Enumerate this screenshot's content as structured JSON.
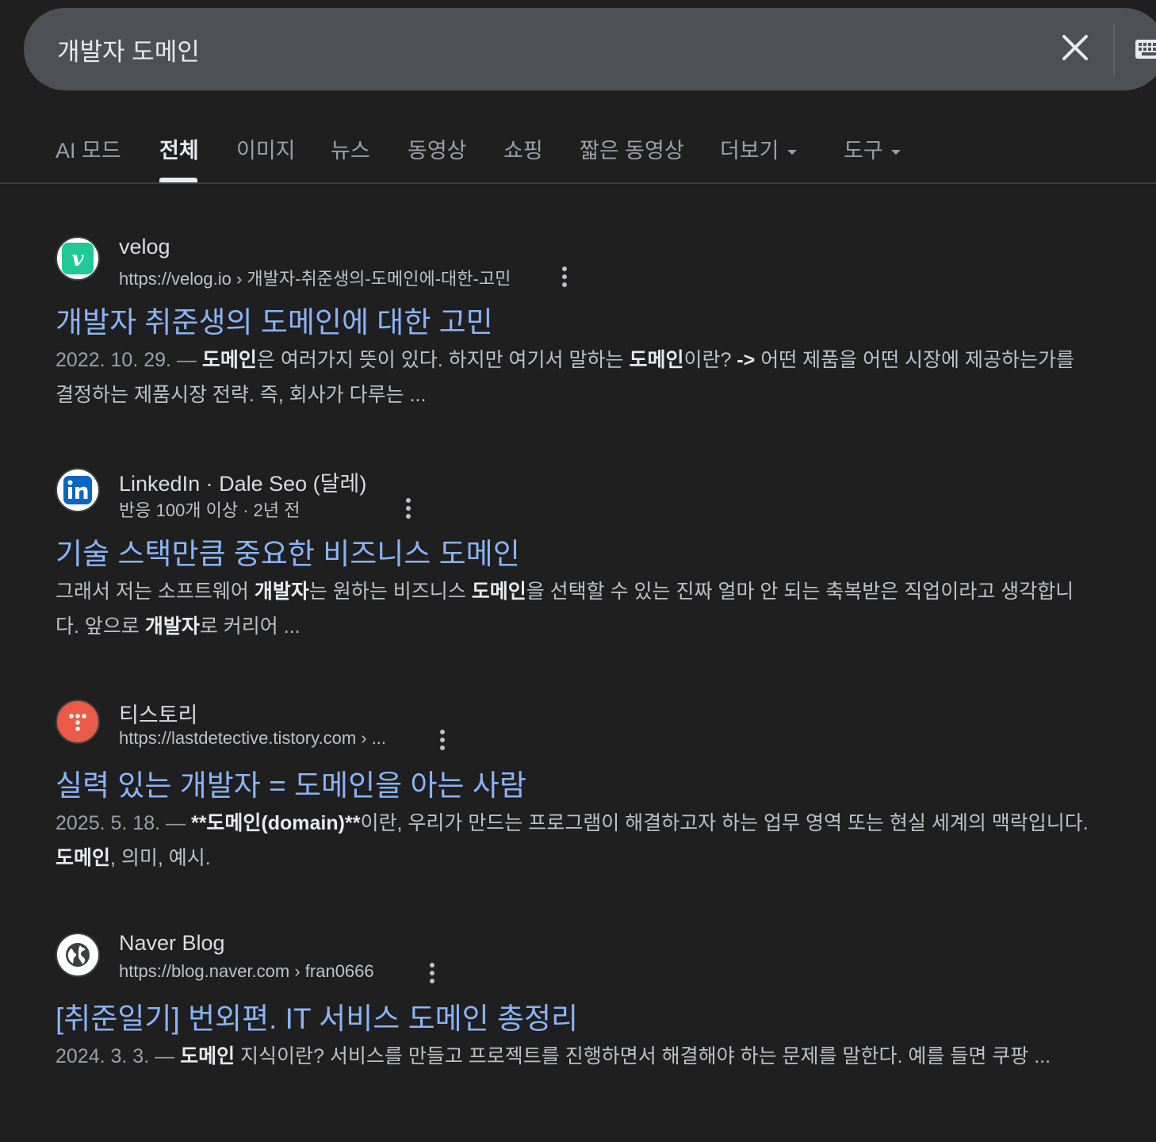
{
  "search": {
    "query": "개발자 도메인"
  },
  "tabs": [
    {
      "label": "AI 모드"
    },
    {
      "label": "전체"
    },
    {
      "label": "이미지"
    },
    {
      "label": "뉴스"
    },
    {
      "label": "동영상"
    },
    {
      "label": "쇼핑"
    },
    {
      "label": "짧은 동영상"
    },
    {
      "label": "더보기"
    },
    {
      "label": "도구"
    }
  ],
  "active_tab": "전체",
  "colors": {
    "background": "#1f1f1f",
    "search_bar": "#4d5156",
    "link": "#8ab4f8",
    "velog": "#20c997",
    "linkedin": "#0a66c2",
    "tistory": "#eb5a47"
  },
  "results": [
    {
      "icon": "velog-icon",
      "site": "velog",
      "url": "https://velog.io › 개발자-취준생의-도메인에-대한-고민",
      "title": "개발자 취준생의 도메인에 대한 고민",
      "snippet": {
        "date": "2022. 10. 29. —",
        "parts": [
          " ",
          "도메인",
          "은 여러가지 뜻이 있다. 하지만 여기서 말하는 ",
          "도메인",
          "이란? ",
          "->",
          " 어떤 제품을 어떤 시장에 제공하는가를 결정하는 제품시장 전략. 즉, 회사가 다루는 ..."
        ]
      }
    },
    {
      "icon": "linkedin-icon",
      "site": "LinkedIn · Dale Seo (달레)",
      "url": "반응 100개 이상 · 2년 전",
      "title": "기술 스택만큼 중요한 비즈니스 도메인",
      "snippet": {
        "date": "",
        "parts": [
          "그래서 저는 소프트웨어 ",
          "개발자",
          "는 원하는 비즈니스 ",
          "도메인",
          "을 선택할 수 있는 진짜 얼마 안 되는 축복받은 직업이라고 생각합니다. 앞으로 ",
          "개발자",
          "로 커리어 ..."
        ]
      }
    },
    {
      "icon": "tistory-icon",
      "site": "티스토리",
      "url": "https://lastdetective.tistory.com › ...",
      "title": "실력 있는 개발자 = 도메인을 아는 사람",
      "snippet": {
        "date": "2025. 5. 18. —",
        "parts": [
          " ",
          "**도메인(domain)**",
          "이란, 우리가 만드는 프로그램이 해결하고자 하는 업무 영역 또는 현실 세계의 맥락입니다. ",
          "도메인",
          ", 의미, 예시."
        ]
      }
    },
    {
      "icon": "globe-icon",
      "site": "Naver Blog",
      "url": "https://blog.naver.com › fran0666",
      "title": "[취준일기] 번외편. IT 서비스 도메인 총정리",
      "snippet": {
        "date": "2024. 3. 3. —",
        "parts": [
          " ",
          "도메인",
          " 지식이란? 서비스를 만들고 프로젝트를 진행하면서 해결해야 하는 문제를 말한다. 예를 들면 쿠팡 ..."
        ]
      }
    }
  ]
}
